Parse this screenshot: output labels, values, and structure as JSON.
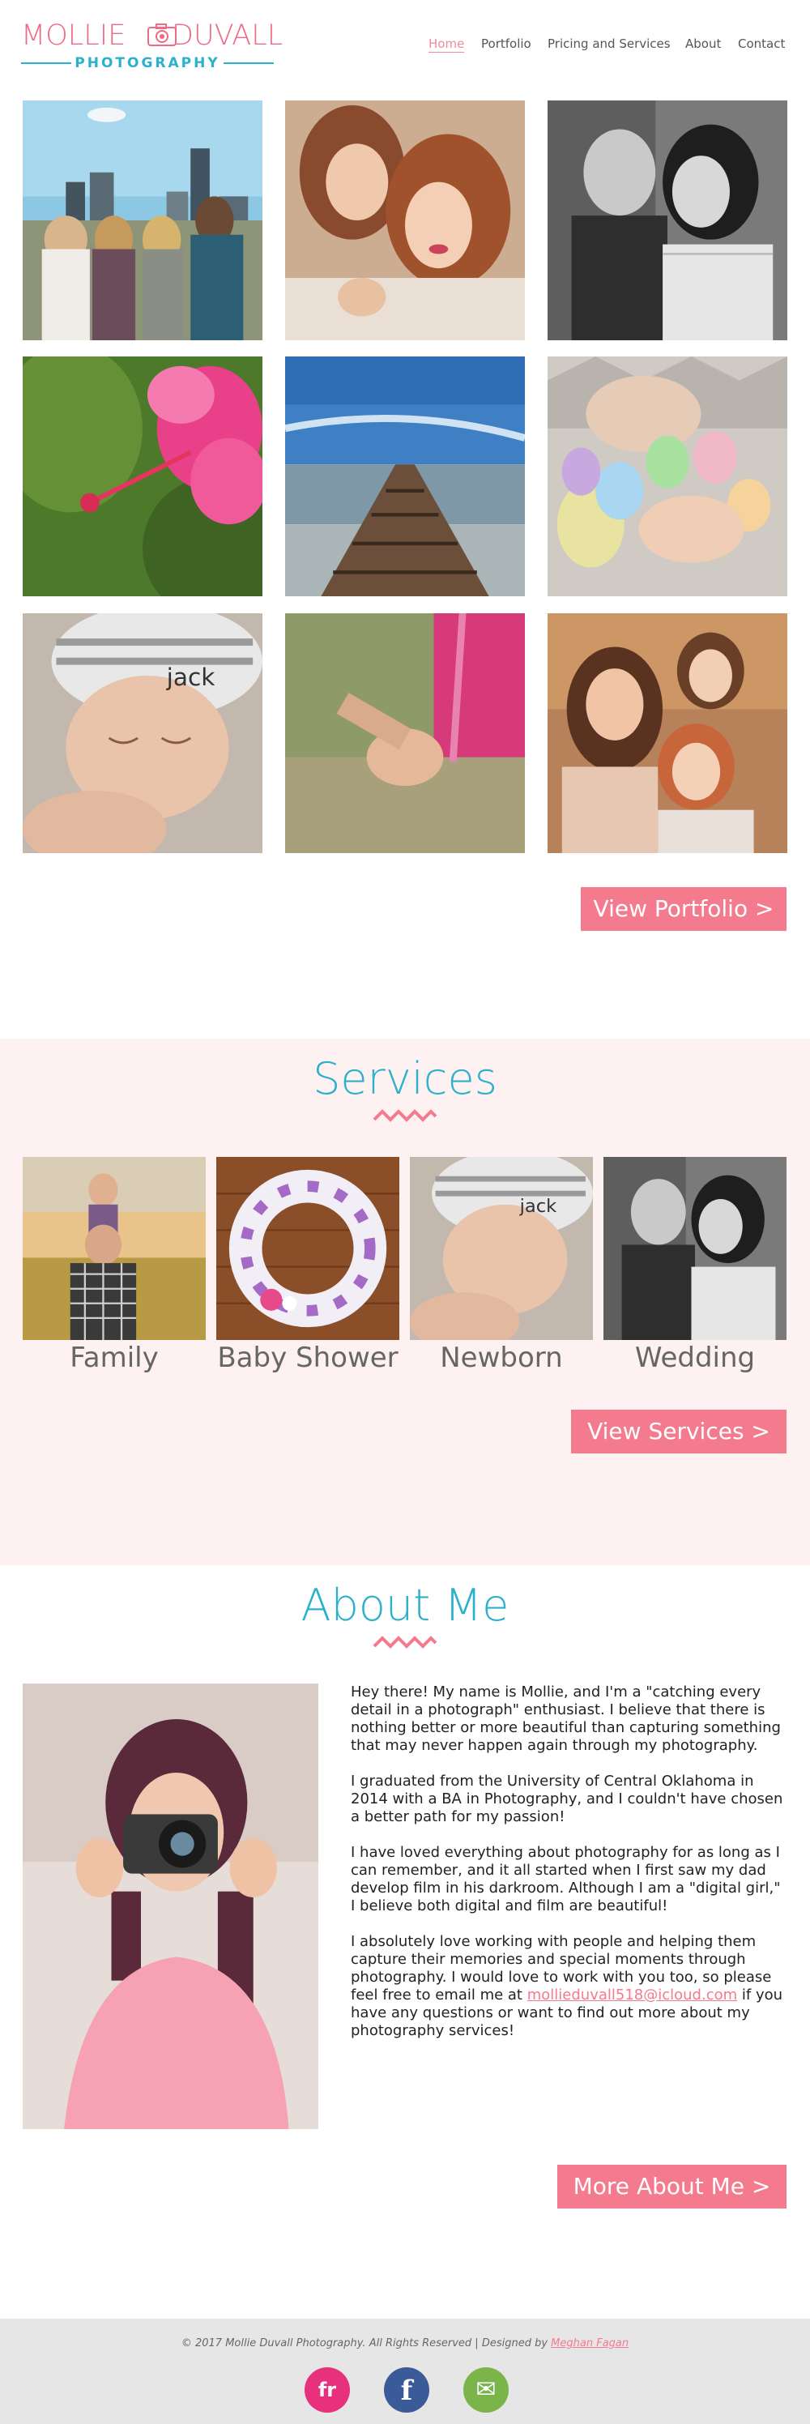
{
  "logo": {
    "word1": "MOLLIE",
    "word2": "DUVALL",
    "subtitle": "PHOTOGRAPHY"
  },
  "nav": {
    "items": [
      {
        "label": "Home",
        "active": true
      },
      {
        "label": "Portfolio"
      },
      {
        "label": "Pricing and Services"
      },
      {
        "label": "About"
      },
      {
        "label": "Contact"
      }
    ]
  },
  "portfolio": {
    "photos": [
      "women-skyline",
      "hugging-women",
      "bw-couple",
      "pink-hibernus",
      "stone-jetty",
      "baby-eggs",
      "sleeping-baby-jack",
      "holding-hands",
      "mother-daughters"
    ],
    "button": "View Portfolio >"
  },
  "services": {
    "title": "Services",
    "items": [
      {
        "label": "Family",
        "photo": "father-daughter-field"
      },
      {
        "label": "Baby Shower",
        "photo": "diaper-wreath"
      },
      {
        "label": "Newborn",
        "photo": "sleeping-baby-jack"
      },
      {
        "label": "Wedding",
        "photo": "bw-couple"
      }
    ],
    "button": "View Services  >"
  },
  "about": {
    "title": "About Me",
    "paragraphs": [
      "Hey there! My name is Mollie, and I'm a \"catching every detail in a photograph\" enthusiast. I believe that there is nothing better or more beautiful than capturing something that may never happen again through my photography.",
      "I graduated from the University of Central Oklahoma in 2014 with a BA in Photography, and I couldn't have chosen a better path for my passion!",
      "I have loved everything about  photography for as long as I can remember, and it all started when I first saw my dad develop film in his darkroom. Although I am a \"digital girl,\" I believe both digital and film are beautiful!"
    ],
    "last_paragraph_before": "I absolutely love working with people and helping them capture their memories and special moments through photography. I would love to work with you too, so please feel free to email me at",
    "email": "mollieduvall518@icloud.com",
    "last_paragraph_after": " if you have any questions or want to find out more about my photography services!",
    "button": "More About Me  >"
  },
  "footer": {
    "copyright": "© 2017 Mollie Duvall Photography. All Rights Reserved  |  Designed by ",
    "designer": "Meghan Fagan",
    "social": [
      {
        "label": "fr",
        "color": "#e8317d",
        "icon": "flickr-icon"
      },
      {
        "label": "f",
        "color": "#3b5a98",
        "icon": "facebook-icon"
      },
      {
        "label": "✉",
        "color": "#7bb44a",
        "icon": "email-icon"
      }
    ]
  },
  "colors": {
    "accent_pink": "#f47a8e",
    "accent_teal": "#2ab1cc",
    "band_pink": "#fef1f1",
    "footer_gray": "#e6e6e6"
  }
}
